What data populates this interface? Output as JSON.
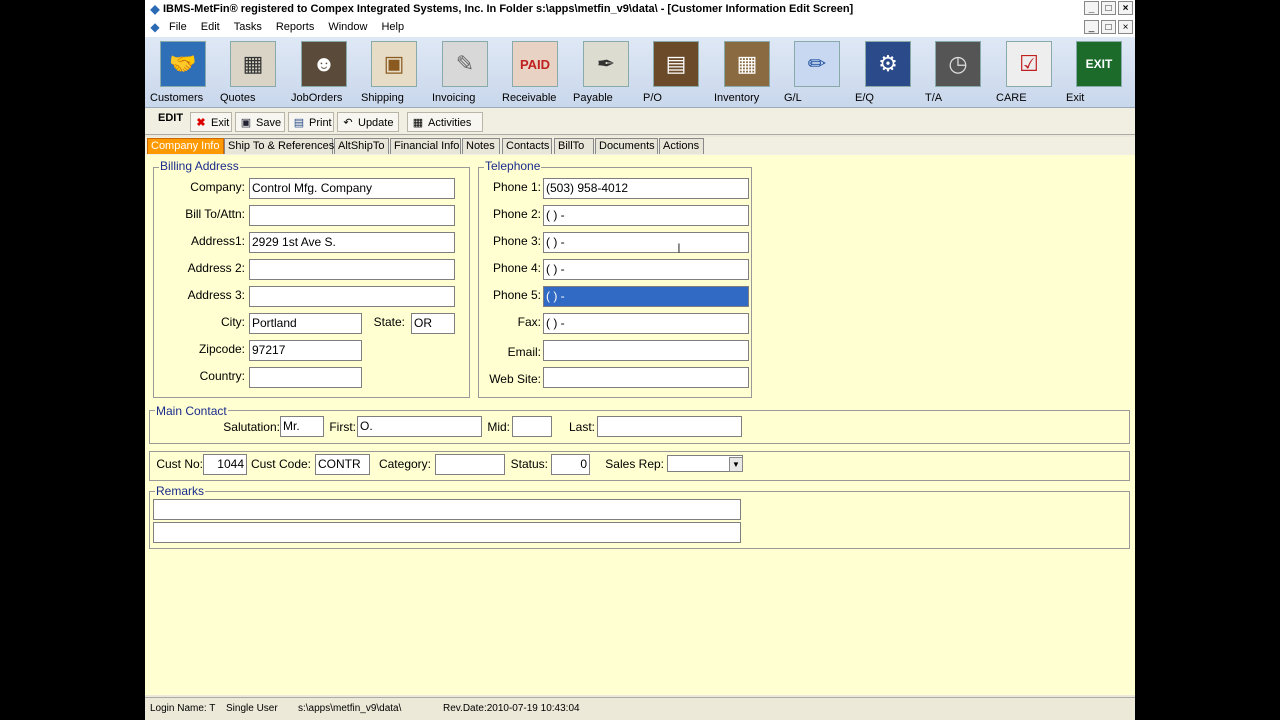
{
  "window": {
    "title": "IBMS-MetFin® registered to Compex Integrated Systems, Inc. In Folder s:\\apps\\metfin_v9\\data\\ - [Customer Information Edit Screen]",
    "min": "_",
    "max": "□",
    "close": "×"
  },
  "menu": [
    "File",
    "Edit",
    "Tasks",
    "Reports",
    "Window",
    "Help"
  ],
  "toolbar": {
    "customers": "Customers",
    "quotes": "Quotes",
    "joborders": "JobOrders",
    "shipping": "Shipping",
    "invoicing": "Invoicing",
    "receivable": "Receivable",
    "payable": "Payable",
    "po": "P/O",
    "inventory": "Inventory",
    "gl": "G/L",
    "eq": "E/Q",
    "ta": "T/A",
    "care": "CARE",
    "exit": "Exit"
  },
  "editbar": {
    "label": "EDIT",
    "exit": "Exit",
    "save": "Save",
    "print": "Print",
    "update": "Update",
    "activities": "Activities"
  },
  "tabs": [
    "Company Info",
    "Ship To & References",
    "AltShipTo",
    "Financial Info",
    "Notes",
    "Contacts",
    "BillTo",
    "Documents",
    "Actions"
  ],
  "billing": {
    "legend": "Billing Address",
    "company_label": "Company:",
    "company": "Control Mfg. Company",
    "billto_label": "Bill To/Attn:",
    "billto": "",
    "address1_label": "Address1:",
    "address1": "2929 1st Ave S.",
    "address2_label": "Address 2:",
    "address2": "",
    "address3_label": "Address 3:",
    "address3": "",
    "city_label": "City:",
    "city": "Portland",
    "state_label": "State:",
    "state": "OR",
    "zip_label": "Zipcode:",
    "zip": "97217",
    "country_label": "Country:",
    "country": ""
  },
  "telephone": {
    "legend": "Telephone",
    "phone1_label": "Phone 1:",
    "phone1": "(503) 958-4012",
    "phone2_label": "Phone 2:",
    "phone2": "(  )   -",
    "phone3_label": "Phone 3:",
    "phone3": "(  )   -",
    "phone4_label": "Phone 4:",
    "phone4": "(  )   -",
    "phone5_label": "Phone 5:",
    "phone5": "(  )   -",
    "fax_label": "Fax:",
    "fax": "(  )   -",
    "email_label": "Email:",
    "email": "",
    "web_label": "Web Site:",
    "web": ""
  },
  "contact": {
    "legend": "Main Contact",
    "salutation_label": "Salutation:",
    "salutation": "Mr.",
    "first_label": "First:",
    "first": "O.",
    "mid_label": "Mid:",
    "mid": "",
    "last_label": "Last:",
    "last": ""
  },
  "custinfo": {
    "custno_label": "Cust No:",
    "custno": "1044",
    "custcode_label": "Cust Code:",
    "custcode": "CONTR",
    "category_label": "Category:",
    "category": "",
    "status_label": "Status:",
    "status": "0",
    "salesrep_label": "Sales Rep:",
    "salesrep": ""
  },
  "remarks": {
    "legend": "Remarks",
    "line1": "",
    "line2": ""
  },
  "status": {
    "login": "Login Name: T",
    "mode": "Single User",
    "folder": "s:\\apps\\metfin_v9\\data\\",
    "revdate": "Rev.Date:2010-07-19 10:43:04"
  },
  "colors": {
    "panel": "#ffffd2",
    "active_tab": "#ff9900",
    "selection": "#316ac5",
    "legend": "#1a2b8c"
  },
  "icons": [
    "handshake-icon",
    "calculator-icon",
    "worker-icon",
    "package-icon",
    "invoice-icon",
    "paid-stamp-icon",
    "pen-sign-icon",
    "warehouse-icon",
    "inventory-shelf-icon",
    "ledger-pens-icon",
    "tools-icon",
    "time-clock-icon",
    "clipboard-icon",
    "exit-sign-icon"
  ]
}
